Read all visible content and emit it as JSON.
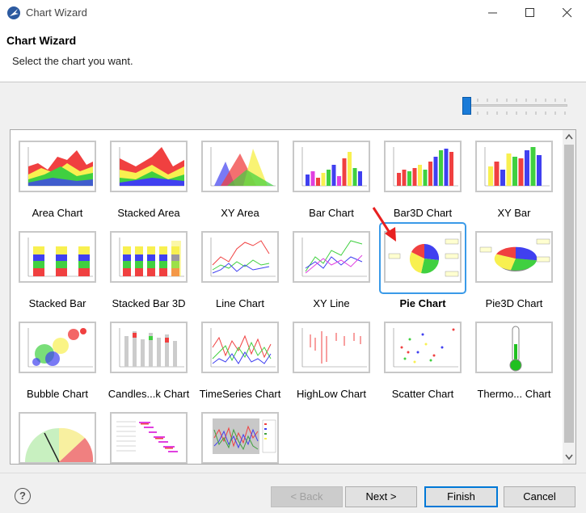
{
  "window": {
    "title": "Chart Wizard"
  },
  "header": {
    "title": "Chart Wizard",
    "subtitle": "Select the chart you want."
  },
  "slider": {
    "value": 0
  },
  "charts": [
    {
      "label": "Area Chart",
      "selected": false
    },
    {
      "label": "Stacked Area",
      "selected": false
    },
    {
      "label": "XY Area",
      "selected": false
    },
    {
      "label": "Bar Chart",
      "selected": false
    },
    {
      "label": "Bar3D Chart",
      "selected": false
    },
    {
      "label": "XY Bar",
      "selected": false
    },
    {
      "label": "Stacked Bar",
      "selected": false
    },
    {
      "label": "Stacked Bar 3D",
      "selected": false
    },
    {
      "label": "Line Chart",
      "selected": false
    },
    {
      "label": "XY Line",
      "selected": false
    },
    {
      "label": "Pie Chart",
      "selected": true
    },
    {
      "label": "Pie3D Chart",
      "selected": false
    },
    {
      "label": "Bubble Chart",
      "selected": false
    },
    {
      "label": "Candles...k Chart",
      "selected": false
    },
    {
      "label": "TimeSeries Chart",
      "selected": false
    },
    {
      "label": "HighLow Chart",
      "selected": false
    },
    {
      "label": "Scatter Chart",
      "selected": false
    },
    {
      "label": "Thermo... Chart",
      "selected": false
    },
    {
      "label": "",
      "selected": false
    },
    {
      "label": "",
      "selected": false
    },
    {
      "label": "",
      "selected": false
    }
  ],
  "buttons": {
    "back": "< Back",
    "next": "Next >",
    "finish": "Finish",
    "cancel": "Cancel"
  },
  "help": {
    "label": "?"
  },
  "colors": {
    "accent": "#3a9ae8",
    "red": "#f04040",
    "yellow": "#f8f050",
    "green": "#40d040",
    "blue": "#4040f0"
  }
}
